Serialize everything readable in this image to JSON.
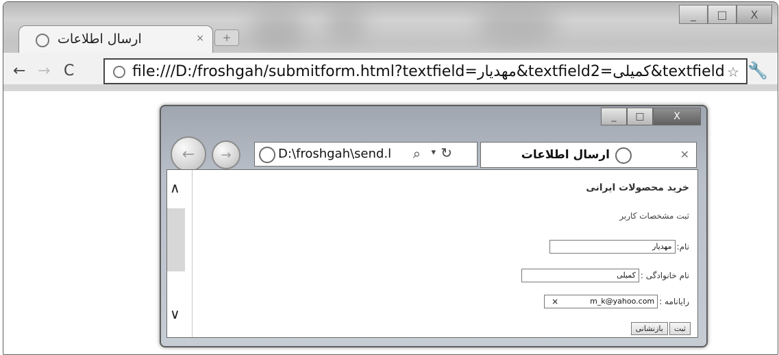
{
  "chrome": {
    "tab_title": "ارسال اطلاعات",
    "url": "file:///D:/froshgah/submitform.html?textfield=مهدیار&textfield2=کمیلی&textfield"
  },
  "ie": {
    "address": "D:\\froshgah\\send.l",
    "tab_title": "ارسال اطلاعات"
  },
  "form": {
    "title": "خرید محصولات ایرانی",
    "subtitle": "ثبت مشخصات کاربر",
    "name_label": "نام:",
    "name_value": "مهدیار",
    "family_label": "نام خانوادگی :",
    "family_value": "کمیلی",
    "email_label": "رایانامه :",
    "email_value": "m_k@yahoo.com",
    "submit_label": "ثبت",
    "reset_label": "بازنشانی"
  }
}
